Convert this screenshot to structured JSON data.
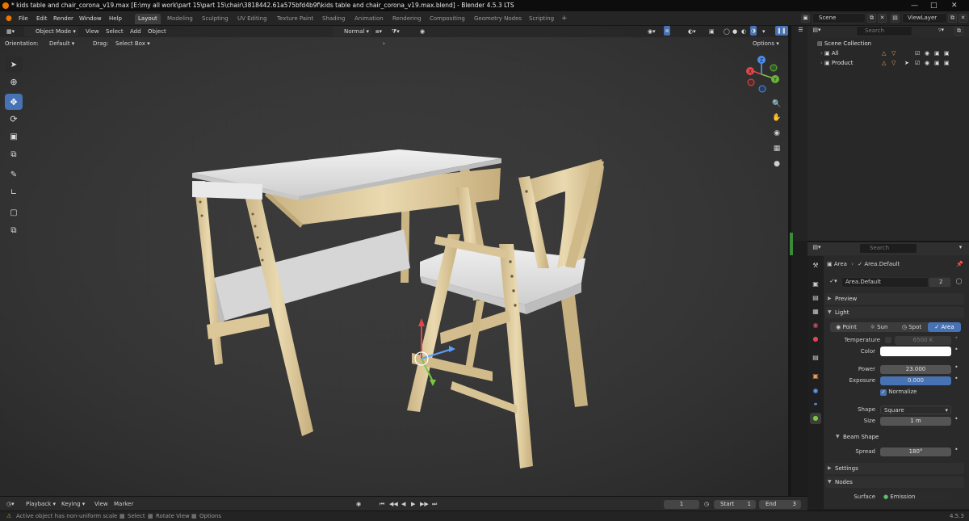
{
  "titlebar": {
    "title": "* kids table and chair_corona_v19.max [E:\\my all work\\part 15\\part 15\\chair\\3818442.61a575bfd4b9f\\kids table and chair_corona_v19.max.blend] - Blender 4.5.3 LTS"
  },
  "menu": {
    "file": "File",
    "edit": "Edit",
    "render": "Render",
    "window": "Window",
    "help": "Help"
  },
  "workspaces": [
    "Layout",
    "Modeling",
    "Sculpting",
    "UV Editing",
    "Texture Paint",
    "Shading",
    "Animation",
    "Rendering",
    "Compositing",
    "Geometry Nodes",
    "Scripting"
  ],
  "top_right": {
    "scene": "Scene",
    "view_layer": "ViewLayer"
  },
  "viewport_header": {
    "mode": "Object Mode",
    "view": "View",
    "select": "Select",
    "add": "Add",
    "object": "Object",
    "transform_orientation": "Normal",
    "orientation_label": "Orientation:",
    "orientation_value": "Default",
    "drag_label": "Drag:",
    "drag_value": "Select Box",
    "options": "Options"
  },
  "outliner": {
    "search_placeholder": "Search",
    "scene_collection": "Scene Collection",
    "items": [
      "All",
      "Product"
    ]
  },
  "properties": {
    "search_placeholder": "Search",
    "breadcrumb_object": "Area",
    "breadcrumb_data": "Area.Default",
    "datablock_name": "Area.Default",
    "user_count": "2",
    "panels": {
      "preview": "Preview",
      "light": "Light",
      "beam_shape": "Beam Shape",
      "settings": "Settings",
      "nodes": "Nodes"
    },
    "light_types": [
      "Point",
      "Sun",
      "Spot",
      "Area"
    ],
    "active_light_type": "Area",
    "temperature_label": "Temperature",
    "temperature_value": "6500 K",
    "color_label": "Color",
    "light_color": "#ffffff",
    "power_label": "Power",
    "power_value": "23.000",
    "exposure_label": "Exposure",
    "exposure_value": "0.000",
    "normalize_label": "Normalize",
    "shape_label": "Shape",
    "shape_value": "Square",
    "size_label": "Size",
    "size_value": "1 m",
    "spread_label": "Spread",
    "spread_value": "180°",
    "surface_label": "Surface",
    "surface_value": "Emission"
  },
  "timeline": {
    "playback": "Playback",
    "keying": "Keying",
    "view": "View",
    "marker": "Marker",
    "current_frame": "1",
    "start_label": "Start",
    "start_value": "1",
    "end_label": "End",
    "end_value": "3"
  },
  "statusbar": {
    "warning": "Active object has non-uniform scale",
    "select": "Select",
    "rotate_view": "Rotate View",
    "options": "Options",
    "version": "4.5.3"
  },
  "colors": {
    "accent": "#4772b3",
    "blender_orange": "#ea7600",
    "wood": "#e0cfa4",
    "white_panel": "#e6e6e6"
  }
}
